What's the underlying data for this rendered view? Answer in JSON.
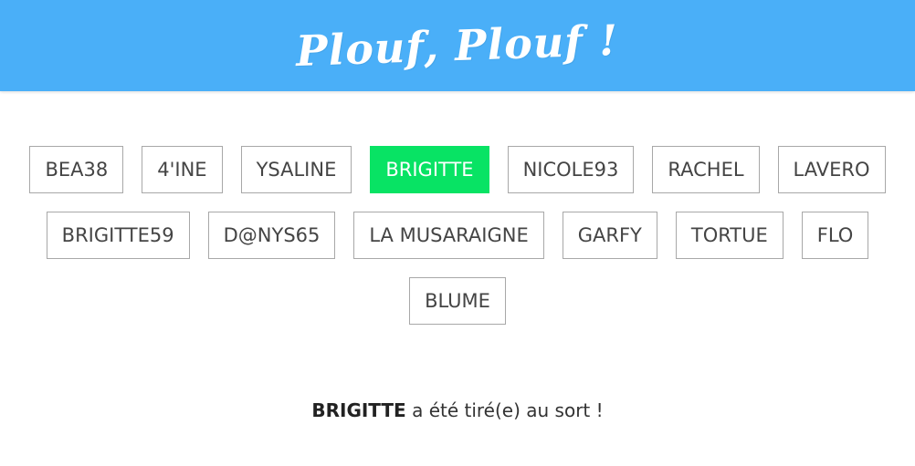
{
  "header": {
    "title": "Plouf, Plouf !",
    "background_color": "#4aaff8"
  },
  "names": {
    "rows": [
      [
        "BEA38",
        "4'INE",
        "YSALINE",
        "BRIGITTE",
        "NICOLE93",
        "RACHEL",
        "LAVERO"
      ],
      [
        "BRIGITTE59",
        "D@NYS65",
        "LA MUSARAIGNE",
        "GARFY",
        "TORTUE",
        "FLO"
      ],
      [
        "BLUME"
      ]
    ],
    "selected": "BRIGITTE",
    "selected_color": "#08e364"
  },
  "result": {
    "name": "BRIGITTE",
    "suffix": " a été tiré(e) au sort !"
  }
}
